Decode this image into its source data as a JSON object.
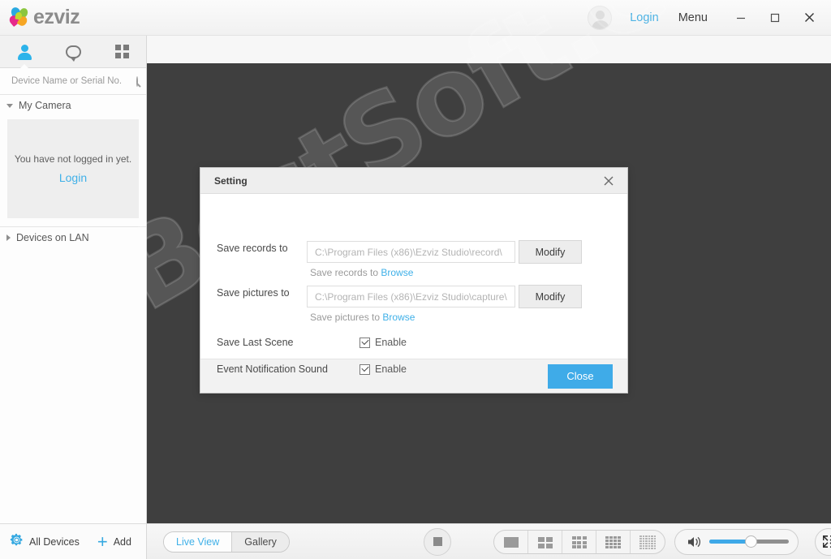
{
  "titlebar": {
    "brand": "ezviz",
    "brand_icon": "ezviz-flower-logo",
    "login_label": "Login",
    "menu_label": "Menu",
    "minimize_icon": "minimize-icon",
    "maximize_icon": "maximize-icon",
    "close_icon": "close-icon",
    "avatar_icon": "user-avatar-placeholder"
  },
  "sidebar": {
    "tabs": [
      {
        "name": "devices-tab",
        "icon": "person-icon",
        "active": true
      },
      {
        "name": "messages-tab",
        "icon": "chat-bubble-icon",
        "active": false
      },
      {
        "name": "apps-tab",
        "icon": "grid-four-icon",
        "active": false
      }
    ],
    "search": {
      "placeholder": "Device Name or Serial No.",
      "value": "",
      "icon": "search-icon"
    },
    "groups": [
      {
        "label": "My Camera",
        "expanded": true
      },
      {
        "label": "Devices on LAN",
        "expanded": false
      }
    ],
    "empty_state": {
      "text": "You have not logged in yet.",
      "link": "Login"
    },
    "footer": {
      "all_devices_label": "All Devices",
      "all_devices_icon": "gear-icon",
      "add_label": "Add",
      "add_icon": "plus-icon"
    }
  },
  "bottombar": {
    "segments": [
      {
        "label": "Live View",
        "active": true
      },
      {
        "label": "Gallery",
        "active": false
      }
    ],
    "stop_icon": "stop-record-icon",
    "layouts": [
      {
        "name": "layout-1x1",
        "icon": "grid-1-icon"
      },
      {
        "name": "layout-2x2",
        "icon": "grid-4-icon"
      },
      {
        "name": "layout-3x3",
        "icon": "grid-9-icon"
      },
      {
        "name": "layout-4x4",
        "icon": "grid-16-icon"
      },
      {
        "name": "layout-6x6",
        "icon": "grid-36-icon"
      }
    ],
    "volume": {
      "icon": "speaker-icon",
      "percent": 52
    },
    "fullscreen_icon": "fullscreen-icon"
  },
  "dialog": {
    "title": "Setting",
    "close_icon": "close-icon",
    "rows": [
      {
        "label": "Save records to",
        "value": "C:\\Program Files (x86)\\Ezviz Studio\\record\\",
        "button": "Modify",
        "hint_prefix": "Save records to ",
        "hint_link": "Browse"
      },
      {
        "label": "Save pictures to",
        "value": "C:\\Program Files (x86)\\Ezviz Studio\\capture\\",
        "button": "Modify",
        "hint_prefix": "Save pictures to ",
        "hint_link": "Browse"
      }
    ],
    "toggles": [
      {
        "label": "Save Last Scene",
        "checkbox_label": "Enable",
        "checked": true
      },
      {
        "label": "Event Notification Sound",
        "checkbox_label": "Enable",
        "checked": true
      }
    ],
    "close_button": "Close"
  },
  "watermark": {
    "text": "BestSoft.Club"
  },
  "colors": {
    "accent": "#3fabe8",
    "link": "#36a9e1",
    "video_bg": "#3f3f3f",
    "titlebar_bg": "#f1f1f1"
  }
}
